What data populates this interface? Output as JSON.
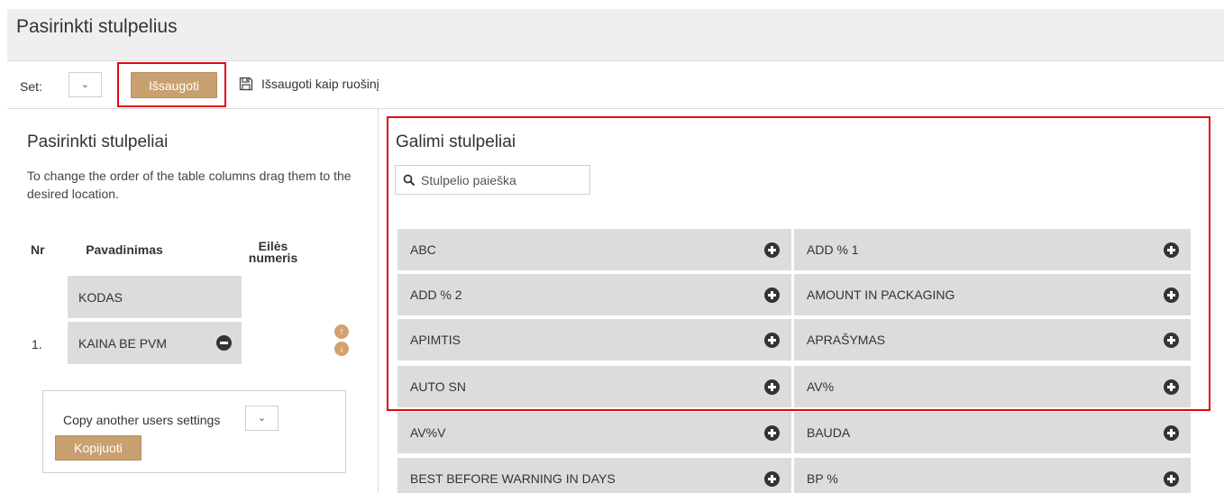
{
  "header": {
    "title": "Pasirinkti stulpelius"
  },
  "toolbar": {
    "set_label": "Set:",
    "save_label": "Išsaugoti",
    "save_draft_label": "Išsaugoti kaip ruošinį"
  },
  "left": {
    "title": "Pasirinkti stulpeliai",
    "hint": "To change the order of the table columns drag them to the desired location.",
    "headers": {
      "nr": "Nr",
      "name": "Pavadinimas",
      "order_line1": "Eilės",
      "order_line2": "numeris"
    },
    "rows": [
      {
        "nr": "",
        "name": "KODAS"
      },
      {
        "nr": "1.",
        "name": "KAINA BE PVM"
      }
    ],
    "copy": {
      "label": "Copy another users settings",
      "button": "Kopijuoti"
    }
  },
  "right": {
    "title": "Galimi stulpeliai",
    "search_placeholder": "Stulpelio paieška",
    "columns": [
      "ABC",
      "ADD % 1",
      "ADD % 2",
      "AMOUNT IN PACKAGING",
      "APIMTIS",
      "APRAŠYMAS",
      "AUTO SN",
      "AV%",
      "AV%V",
      "BAUDA",
      "BEST BEFORE WARNING IN DAYS",
      "BP %"
    ]
  },
  "colors": {
    "button": "#c9a070",
    "highlight": "#e30613",
    "cell": "#dcdcdc",
    "arrow": "#d4a06d"
  }
}
